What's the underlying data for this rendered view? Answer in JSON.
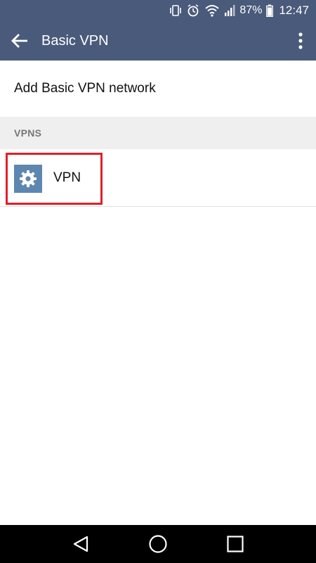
{
  "status_bar": {
    "battery_percent": "87%",
    "time": "12:47",
    "icons": [
      "vibrate-icon",
      "alarm-icon",
      "wifi-icon",
      "signal-icon",
      "battery-icon"
    ]
  },
  "app_bar": {
    "title": "Basic VPN",
    "back_icon": "back-arrow-icon",
    "menu_icon": "overflow-menu-icon"
  },
  "actions": {
    "add_label": "Add Basic VPN network"
  },
  "vpns_section": {
    "header": "VPNS",
    "items": [
      {
        "label": "VPN",
        "icon": "gear-icon"
      }
    ]
  },
  "colors": {
    "app_bar": "#4a5a7a",
    "section_header_bg": "#efefef",
    "vpn_icon_bg": "#5d87b0",
    "highlight": "#e0202a"
  },
  "nav_bar": {
    "icons": [
      "back-triangle-icon",
      "home-circle-icon",
      "recents-square-icon"
    ]
  }
}
